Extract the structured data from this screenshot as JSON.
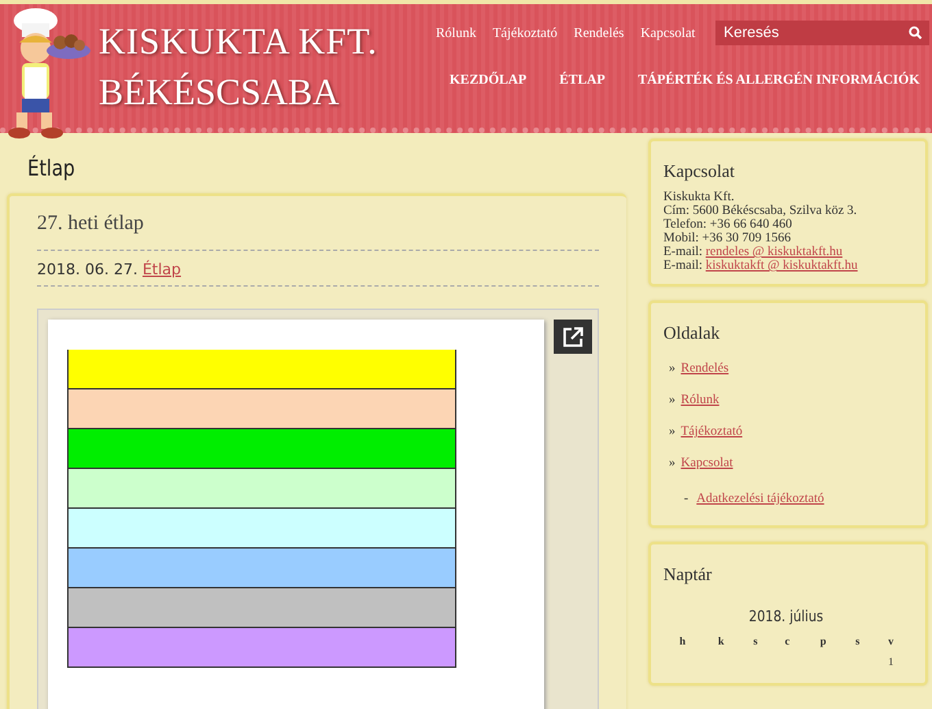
{
  "header": {
    "title": "KISKUKTA KFT.",
    "subtitle": "BÉKÉSCSABA",
    "top_links": [
      "Rólunk",
      "Tájékoztató",
      "Rendelés",
      "Kapcsolat"
    ],
    "search": {
      "placeholder": "Keresés"
    },
    "main_nav": [
      "KEZDŐLAP",
      "ÉTLAP",
      "TÁPÉRTÉK ÉS ALLERGÉN INFORMÁCIÓK"
    ]
  },
  "page_title": "Étlap",
  "post": {
    "title": "27. heti étlap",
    "date": "2018. 06. 27.",
    "category": "Étlap"
  },
  "sidebar": {
    "contact": {
      "title": "Kapcsolat",
      "lines": [
        {
          "text": "Kiskukta Kft."
        },
        {
          "text": "Cím: 5600 Békéscsaba, Szilva köz 3."
        },
        {
          "text": "Telefon: +36 66 640 460"
        },
        {
          "text": "Mobil: +36 30 709 1566"
        },
        {
          "text": "E-mail:",
          "link": "rendeles @ kiskuktakft.hu"
        },
        {
          "text": "E-mail:",
          "link": "kiskuktakft @ kiskuktakft.hu"
        }
      ]
    },
    "pages": {
      "title": "Oldalak",
      "items": [
        {
          "bullet": "»",
          "label": "Rendelés"
        },
        {
          "bullet": "»",
          "label": "Rólunk"
        },
        {
          "bullet": "»",
          "label": "Tájékoztató"
        },
        {
          "bullet": "»",
          "label": "Kapcsolat",
          "children": [
            {
              "bullet": "-",
              "label": "Adatkezelési tájékoztató"
            }
          ]
        }
      ]
    },
    "calendar": {
      "title": "Naptár",
      "month": "2018. július",
      "weekdays": [
        "h",
        "k",
        "s",
        "c",
        "p",
        "s",
        "v"
      ],
      "weeks": [
        [
          "1"
        ]
      ]
    }
  }
}
